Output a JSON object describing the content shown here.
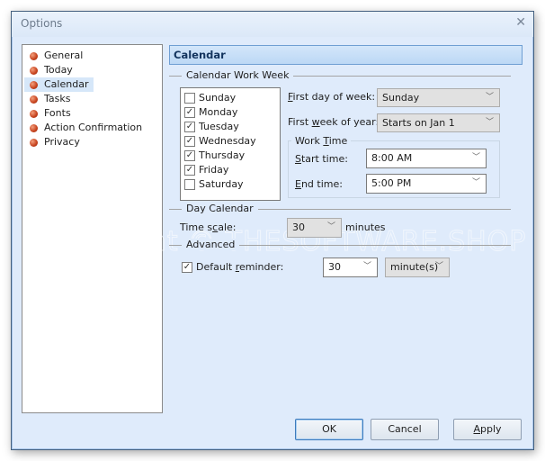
{
  "window": {
    "title": "Options",
    "close_icon": "✕"
  },
  "nav": {
    "items": [
      {
        "label": "General",
        "selected": false
      },
      {
        "label": "Today",
        "selected": false
      },
      {
        "label": "Calendar",
        "selected": true
      },
      {
        "label": "Tasks",
        "selected": false
      },
      {
        "label": "Fonts",
        "selected": false
      },
      {
        "label": "Action Confirmation",
        "selected": false
      },
      {
        "label": "Privacy",
        "selected": false
      }
    ]
  },
  "section_title": "Calendar",
  "work_week": {
    "group_label": "Calendar Work Week",
    "days": [
      {
        "label": "Sunday",
        "checked": false
      },
      {
        "label": "Monday",
        "checked": true
      },
      {
        "label": "Tuesday",
        "checked": true
      },
      {
        "label": "Wednesday",
        "checked": true
      },
      {
        "label": "Thursday",
        "checked": true
      },
      {
        "label": "Friday",
        "checked": true
      },
      {
        "label": "Saturday",
        "checked": false
      }
    ],
    "first_day_label": "irst day of week:",
    "first_day_mnemonic": "F",
    "first_day_value": "Sunday",
    "first_week_label_pre": "First ",
    "first_week_mnemonic": "w",
    "first_week_label_post": "eek of year:",
    "first_week_value": "Starts on Jan 1",
    "work_time": {
      "label_pre": "Work ",
      "label_mnemonic": "T",
      "label_post": "ime",
      "start_mnemonic": "S",
      "start_label": "tart time:",
      "start_value": "8:00 AM",
      "end_mnemonic": "E",
      "end_label": "nd time:",
      "end_value": "5:00 PM"
    }
  },
  "day_calendar": {
    "group_label": "Day Calendar",
    "time_scale_pre": "Time s",
    "time_scale_mnemonic": "c",
    "time_scale_post": "ale:",
    "time_scale_value": "30",
    "time_scale_unit": "minutes"
  },
  "advanced": {
    "group_label": "Advanced",
    "reminder_checked": true,
    "reminder_pre": "Default ",
    "reminder_mnemonic": "r",
    "reminder_post": "eminder:",
    "reminder_value": "30",
    "reminder_unit": "minute(s)"
  },
  "buttons": {
    "ok": "OK",
    "cancel": "Cancel",
    "apply_mnemonic": "A",
    "apply_rest": "pply"
  },
  "watermark": "Copyright © THESOFTWARE.SHOP",
  "icons": {
    "checkmark": "✓",
    "dropdown": "﹀"
  }
}
